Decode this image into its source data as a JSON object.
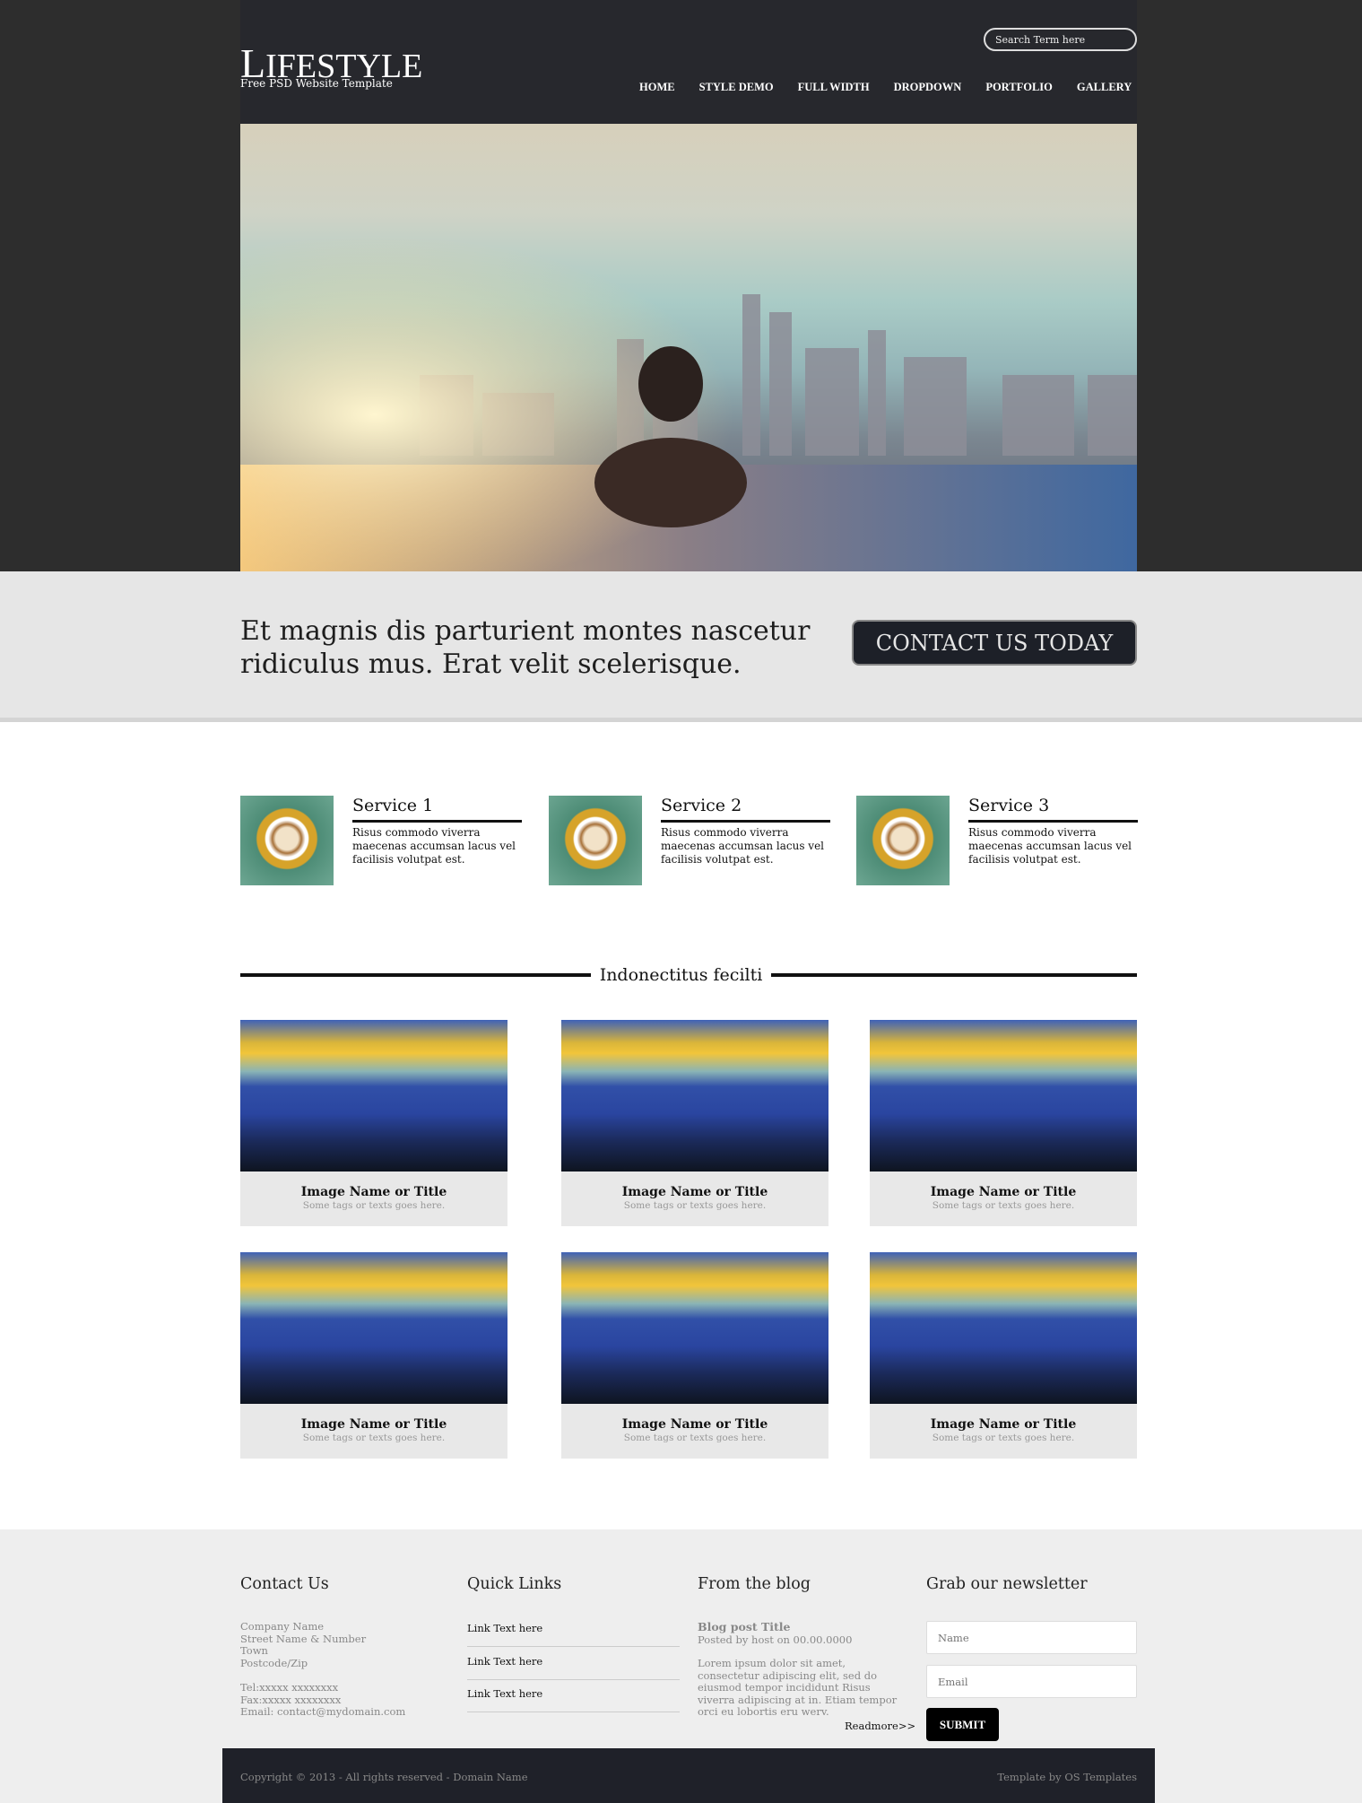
{
  "header": {
    "logo_first": "L",
    "logo_rest": "IFESTYLE",
    "tagline": "Free PSD Website Template",
    "search_placeholder": "Search Term here",
    "nav": [
      "HOME",
      "STYLE DEMO",
      "FULL WIDTH",
      "DROPDOWN",
      "PORTFOLIO",
      "GALLERY"
    ]
  },
  "banner": {
    "text": "Et magnis dis parturient montes nascetur ridiculus mus. Erat velit scelerisque.",
    "cta": "CONTACT US TODAY"
  },
  "services": [
    {
      "title": "Service 1",
      "text": "Risus commodo viverra maecenas accumsan lacus vel facilisis volutpat est."
    },
    {
      "title": "Service 2",
      "text": "Risus commodo viverra maecenas accumsan lacus vel facilisis volutpat est."
    },
    {
      "title": "Service 3",
      "text": "Risus commodo viverra maecenas accumsan lacus vel facilisis volutpat est."
    }
  ],
  "gallery": {
    "heading": "Indonectitus fecilti",
    "items": [
      {
        "title": "Image Name or Title",
        "tags": "Some tags or texts goes here."
      },
      {
        "title": "Image Name or Title",
        "tags": "Some tags or texts goes here."
      },
      {
        "title": "Image Name or Title",
        "tags": "Some tags or texts goes here."
      },
      {
        "title": "Image Name or Title",
        "tags": "Some tags or texts goes here."
      },
      {
        "title": "Image Name or Title",
        "tags": "Some tags or texts goes here."
      },
      {
        "title": "Image Name or Title",
        "tags": "Some tags or texts goes here."
      }
    ]
  },
  "footer": {
    "contact": {
      "heading": "Contact Us",
      "lines": [
        "Company Name",
        "Street Name & Number",
        "Town",
        "Postcode/Zip"
      ],
      "lines2": [
        "Tel:xxxxx xxxxxxxx",
        "Fax:xxxxx xxxxxxxx",
        "Email: contact@mydomain.com"
      ]
    },
    "quick": {
      "heading": "Quick Links",
      "links": [
        "Link Text here",
        "Link Text here",
        "Link Text here"
      ]
    },
    "blog": {
      "heading": "From the blog",
      "post_title": "Blog post Title",
      "posted": "Posted by host on 00.00.0000",
      "excerpt": "Lorem ipsum dolor sit amet, consectetur adipiscing elit, sed do eiusmod tempor incididunt Risus viverra adipiscing at in. Etiam tempor orci eu lobortis eru werv.",
      "readmore": "Readmore>>"
    },
    "newsletter": {
      "heading": "Grab our newsletter",
      "name_placeholder": "Name",
      "email_placeholder": "Email",
      "submit": "SUBMIT"
    },
    "copyright": "Copyright © 2013 - All rights reserved - Domain Name",
    "credit": "Template by OS Templates"
  }
}
